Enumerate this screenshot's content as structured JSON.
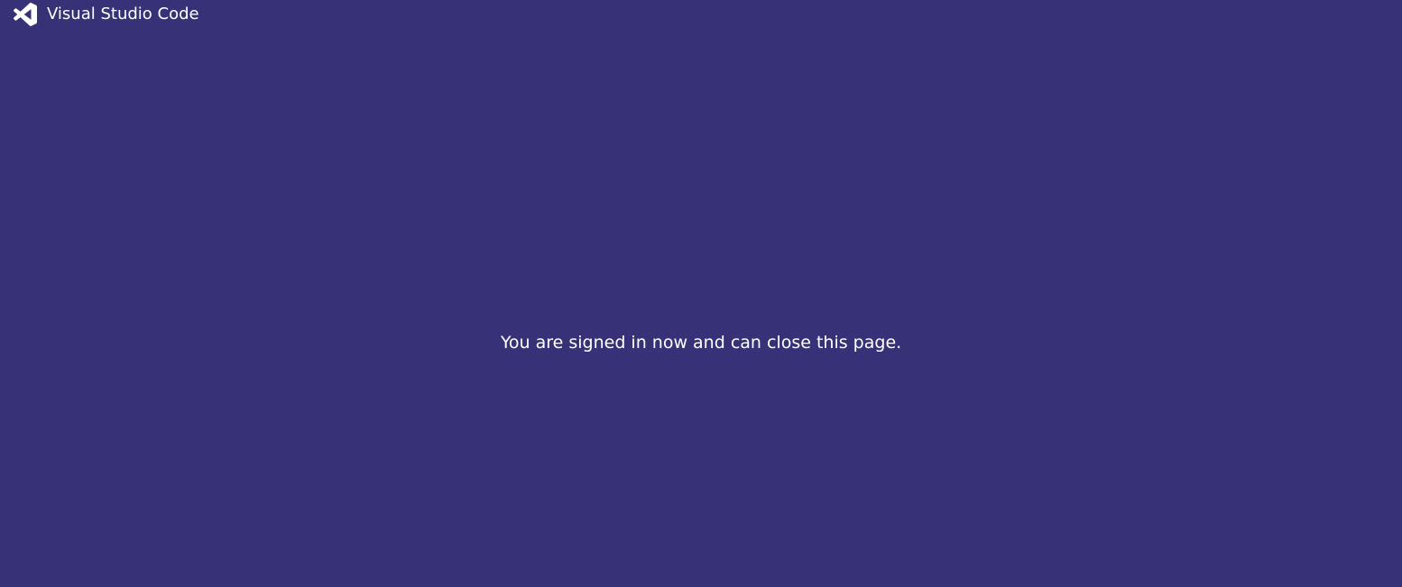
{
  "header": {
    "logo_icon": "vscode-logo-icon",
    "title": "Visual Studio Code"
  },
  "main": {
    "message": "You are signed in now and can close this page."
  },
  "colors": {
    "background": "#373277",
    "text": "#ffffff"
  }
}
